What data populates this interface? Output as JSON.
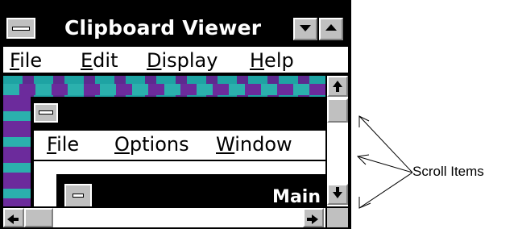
{
  "window": {
    "title": "Clipboard Viewer"
  },
  "menubar": {
    "items": [
      {
        "label_rest": "ile",
        "mnemonic": "F"
      },
      {
        "label_rest": "dit",
        "mnemonic": "E"
      },
      {
        "label_rest": "isplay",
        "mnemonic": "D"
      },
      {
        "label_rest": "elp",
        "mnemonic": "H"
      }
    ]
  },
  "inner_window": {
    "menu": [
      {
        "label_rest": "ile",
        "mnemonic": "F"
      },
      {
        "label_rest": "ptions",
        "mnemonic": "O"
      },
      {
        "label_rest": "indow",
        "mnemonic": "W"
      }
    ],
    "child_title": "Main"
  },
  "annotation": {
    "text": "Scroll Items"
  }
}
